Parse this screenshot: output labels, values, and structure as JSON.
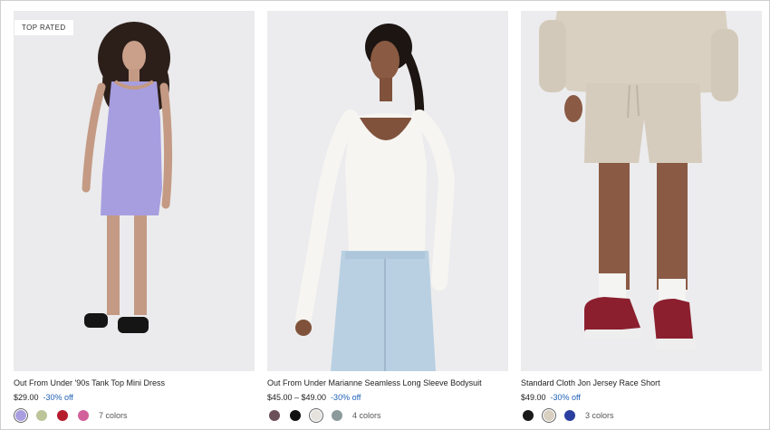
{
  "products": [
    {
      "badge": "TOP RATED",
      "name": "Out From Under '90s Tank Top Mini Dress",
      "price": "$29.00",
      "discount": "-30% off",
      "swatch_colors": [
        "#a99fe0",
        "#bcc49a",
        "#b51d2c",
        "#d2609b"
      ],
      "selected_swatch": 0,
      "colors_label": "7 colors",
      "image": "woman-lavender-tank-dress",
      "image_bg": "#ebebed"
    },
    {
      "name": "Out From Under Marianne Seamless Long Sleeve Bodysuit",
      "price": "$45.00 – $49.00",
      "discount": "-30% off",
      "swatch_colors": [
        "#6c5059",
        "#111111",
        "#e6e3de",
        "#8c9a9c"
      ],
      "selected_swatch": 2,
      "colors_label": "4 colors",
      "image": "woman-white-bodysuit-jeans",
      "image_bg": "#ececee"
    },
    {
      "name": "Standard Cloth Jon Jersey Race Short",
      "price": "$49.00",
      "discount": "-30% off",
      "swatch_colors": [
        "#1a1a1a",
        "#d9d0c2",
        "#2a3fa0"
      ],
      "selected_swatch": 1,
      "colors_label": "3 colors",
      "image": "man-beige-sweat-shorts",
      "image_bg": "#ececee"
    }
  ]
}
